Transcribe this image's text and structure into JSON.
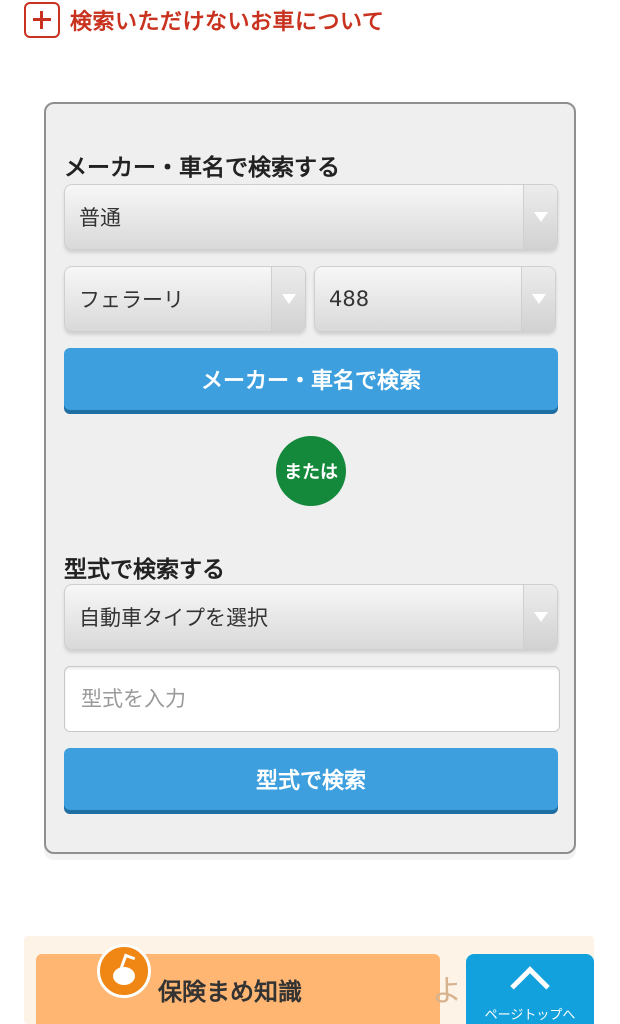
{
  "notice": {
    "text": "検索いただけないお車について",
    "icon": "plus-box-icon",
    "color": "#c8321e"
  },
  "maker_search": {
    "title": "メーカー・車名で検索する",
    "category_select": "普通",
    "maker_select": "フェラーリ",
    "model_select": "488",
    "button_label": "メーカー・車名で検索"
  },
  "divider": {
    "or_label": "または"
  },
  "type_search": {
    "title": "型式で検索する",
    "type_select": "自動車タイプを選択",
    "input_placeholder": "型式を入力",
    "button_label": "型式で検索"
  },
  "footer": {
    "knowledge_label": "保険まめ知識",
    "partial_text": "よ",
    "pagetop_label": "ページトップへ"
  },
  "colors": {
    "accent_red": "#c8321e",
    "button_blue": "#3d9fdd",
    "or_green": "#15893b",
    "knowledge_orange": "#ffb673",
    "pagetop_blue": "#13a1dd"
  }
}
